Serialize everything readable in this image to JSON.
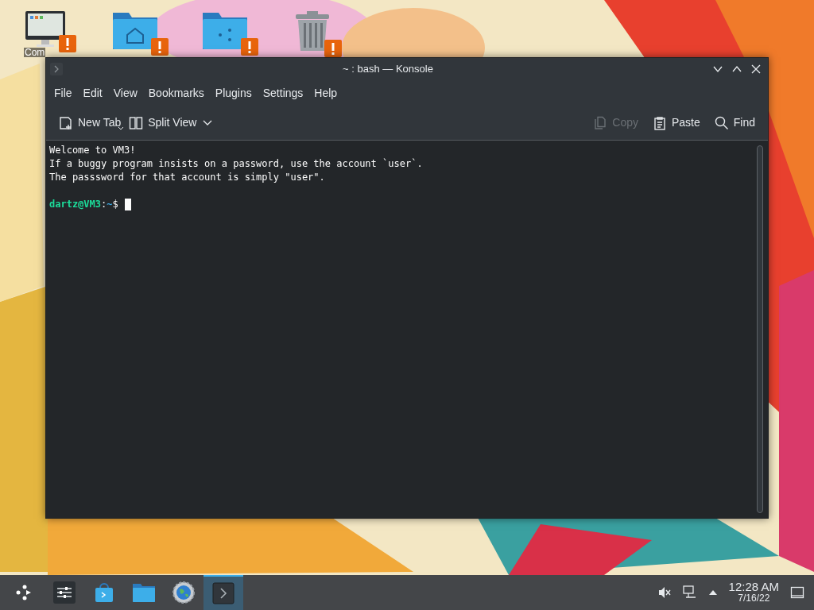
{
  "desktop": {
    "icons": [
      {
        "kind": "computer",
        "label": "Com",
        "warning": true
      },
      {
        "kind": "home",
        "warning": true
      },
      {
        "kind": "folder",
        "warning": true
      },
      {
        "kind": "trash",
        "warning": true
      }
    ]
  },
  "window": {
    "title": "~ : bash — Konsole",
    "menu": [
      "File",
      "Edit",
      "View",
      "Bookmarks",
      "Plugins",
      "Settings",
      "Help"
    ],
    "toolbar": {
      "left": [
        {
          "kind": "new-tab",
          "label": "New Tab",
          "disabled": false
        },
        {
          "kind": "split-view",
          "label": "Split View",
          "disabled": false
        }
      ],
      "right": [
        {
          "kind": "copy",
          "label": "Copy",
          "disabled": true
        },
        {
          "kind": "paste",
          "label": "Paste",
          "disabled": false
        },
        {
          "kind": "find",
          "label": "Find",
          "disabled": false
        }
      ]
    },
    "terminal": {
      "lines": [
        "Welcome to VM3!",
        "If a buggy program insists on a password, use the account `user`.",
        "The passsword for that account is simply \"user\"."
      ],
      "prompt": {
        "user_host": "dartz@VM3",
        "separator": ":",
        "path": "~",
        "symbol": "$"
      }
    }
  },
  "taskbar": {
    "apps": [
      {
        "kind": "launcher",
        "selected": false
      },
      {
        "kind": "settings",
        "selected": false
      },
      {
        "kind": "store",
        "selected": false
      },
      {
        "kind": "files",
        "selected": false
      },
      {
        "kind": "browser",
        "selected": false
      },
      {
        "kind": "terminal",
        "selected": true
      }
    ],
    "tray": {
      "muted": true
    },
    "clock": {
      "time": "12:28 AM",
      "date": "7/16/22"
    }
  }
}
